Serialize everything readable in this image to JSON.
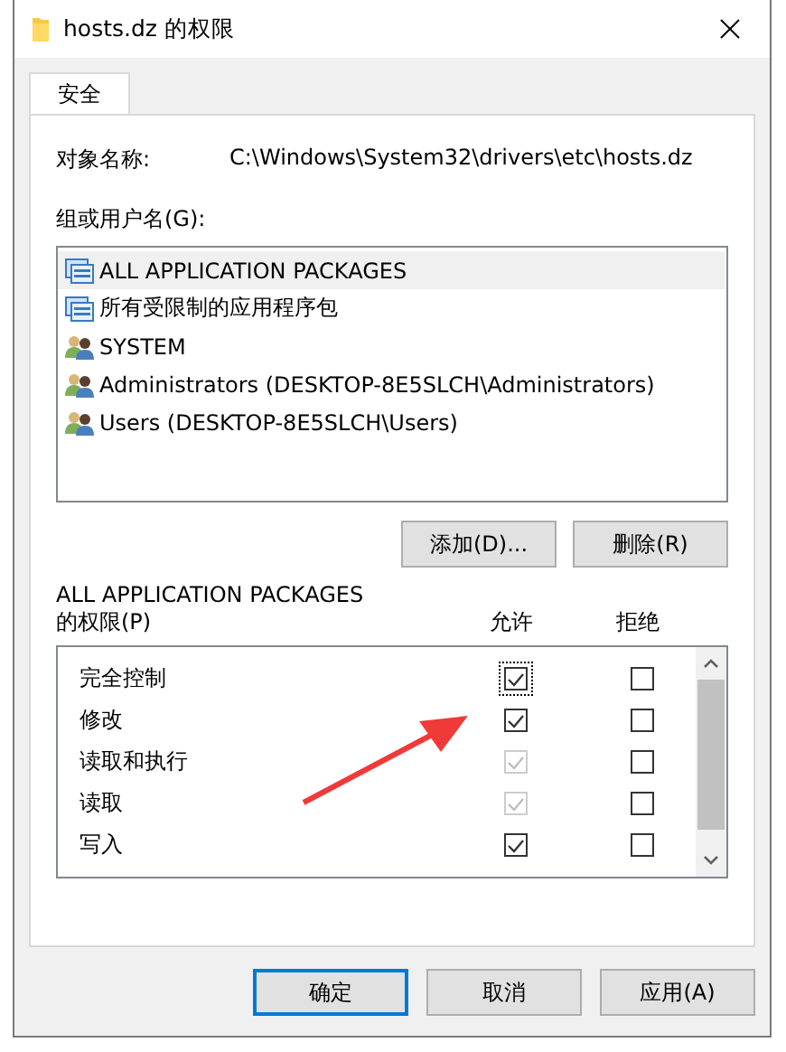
{
  "window": {
    "title": "hosts.dz 的权限"
  },
  "tabs": [
    {
      "label": "安全",
      "selected": true
    }
  ],
  "object_name": {
    "label": "对象名称:",
    "value": "C:\\Windows\\System32\\drivers\\etc\\hosts.dz"
  },
  "principals": {
    "label": "组或用户名(G):",
    "items": [
      {
        "name": "ALL APPLICATION PACKAGES",
        "kind": "package",
        "selected": true
      },
      {
        "name": "所有受限制的应用程序包",
        "kind": "package",
        "selected": false
      },
      {
        "name": "SYSTEM",
        "kind": "users",
        "selected": false
      },
      {
        "name": "Administrators (DESKTOP-8E5SLCH\\Administrators)",
        "kind": "users",
        "selected": false
      },
      {
        "name": "Users (DESKTOP-8E5SLCH\\Users)",
        "kind": "users",
        "selected": false
      }
    ]
  },
  "principal_buttons": [
    "添加(D)...",
    "删除(R)"
  ],
  "permissions": {
    "title": "ALL APPLICATION PACKAGES",
    "subtitle": "的权限(P)",
    "allow_header": "允许",
    "deny_header": "拒绝",
    "rows": [
      {
        "name": "完全控制",
        "allow": {
          "checked": true,
          "disabled": false,
          "focused": true
        },
        "deny": {
          "checked": false,
          "disabled": false
        }
      },
      {
        "name": "修改",
        "allow": {
          "checked": true,
          "disabled": false
        },
        "deny": {
          "checked": false,
          "disabled": false
        }
      },
      {
        "name": "读取和执行",
        "allow": {
          "checked": true,
          "disabled": true
        },
        "deny": {
          "checked": false,
          "disabled": false
        }
      },
      {
        "name": "读取",
        "allow": {
          "checked": true,
          "disabled": true
        },
        "deny": {
          "checked": false,
          "disabled": false
        }
      },
      {
        "name": "写入",
        "allow": {
          "checked": true,
          "disabled": false
        },
        "deny": {
          "checked": false,
          "disabled": false
        }
      }
    ]
  },
  "buttons": [
    {
      "label": "确定",
      "default": true
    },
    {
      "label": "取消",
      "default": false
    },
    {
      "label": "应用(A)",
      "default": false
    }
  ]
}
